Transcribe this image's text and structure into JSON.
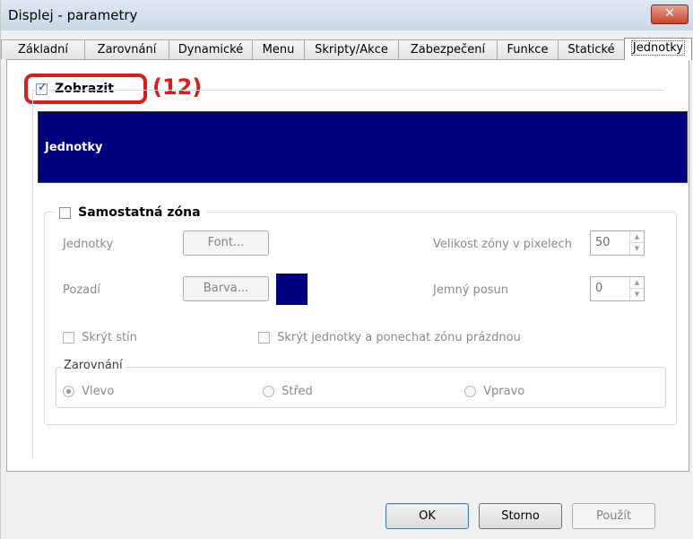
{
  "window": {
    "title": "Displej - parametry",
    "close_glyph": "✕"
  },
  "tabs": [
    {
      "label": "Základní"
    },
    {
      "label": "Zarovnání"
    },
    {
      "label": "Dynamické"
    },
    {
      "label": "Menu"
    },
    {
      "label": "Skripty/Akce"
    },
    {
      "label": "Zabezpečení"
    },
    {
      "label": "Funkce"
    },
    {
      "label": "Statické"
    },
    {
      "label": "Jednotky"
    }
  ],
  "active_tab": "Jednotky",
  "show": {
    "label": "Zobrazit",
    "checked": true,
    "annotation": "(12)",
    "annotation_color": "#d91c1c"
  },
  "preview": {
    "text": "Jednotky",
    "background": "#00007f",
    "text_color": "#ffffff"
  },
  "zone": {
    "label": "Samostatná zóna",
    "checked": false,
    "units_label": "Jednotky",
    "font_button": "Font...",
    "background_label": "Pozadí",
    "color_button": "Barva...",
    "swatch_color": "#00007f",
    "size_label": "Velikost zóny v pixelech",
    "size_value": "50",
    "fine_label": "Jemný posun",
    "fine_value": "0",
    "hide_shadow": "Skrýt stín",
    "hide_units": "Skrýt jednotky a ponechat zónu prázdnou"
  },
  "alignment": {
    "legend": "Zarovnání",
    "left": "Vlevo",
    "center": "Střed",
    "right": "Vpravo",
    "selected": "Vlevo"
  },
  "footer": {
    "ok": "OK",
    "cancel": "Storno",
    "apply": "Použít"
  }
}
